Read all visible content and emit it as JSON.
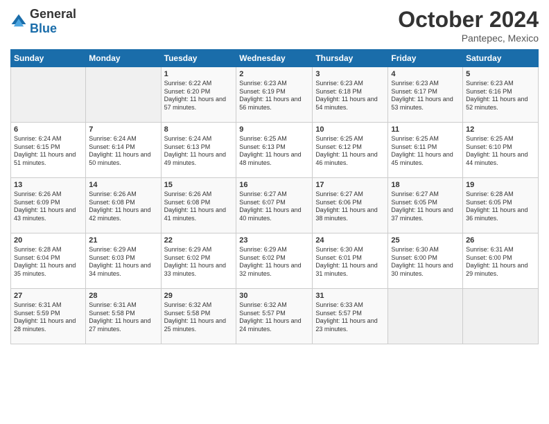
{
  "logo": {
    "general": "General",
    "blue": "Blue"
  },
  "title": "October 2024",
  "subtitle": "Pantepec, Mexico",
  "days_header": [
    "Sunday",
    "Monday",
    "Tuesday",
    "Wednesday",
    "Thursday",
    "Friday",
    "Saturday"
  ],
  "weeks": [
    [
      {
        "day": "",
        "info": ""
      },
      {
        "day": "",
        "info": ""
      },
      {
        "day": "1",
        "info": "Sunrise: 6:22 AM\nSunset: 6:20 PM\nDaylight: 11 hours and 57 minutes."
      },
      {
        "day": "2",
        "info": "Sunrise: 6:23 AM\nSunset: 6:19 PM\nDaylight: 11 hours and 56 minutes."
      },
      {
        "day": "3",
        "info": "Sunrise: 6:23 AM\nSunset: 6:18 PM\nDaylight: 11 hours and 54 minutes."
      },
      {
        "day": "4",
        "info": "Sunrise: 6:23 AM\nSunset: 6:17 PM\nDaylight: 11 hours and 53 minutes."
      },
      {
        "day": "5",
        "info": "Sunrise: 6:23 AM\nSunset: 6:16 PM\nDaylight: 11 hours and 52 minutes."
      }
    ],
    [
      {
        "day": "6",
        "info": "Sunrise: 6:24 AM\nSunset: 6:15 PM\nDaylight: 11 hours and 51 minutes."
      },
      {
        "day": "7",
        "info": "Sunrise: 6:24 AM\nSunset: 6:14 PM\nDaylight: 11 hours and 50 minutes."
      },
      {
        "day": "8",
        "info": "Sunrise: 6:24 AM\nSunset: 6:13 PM\nDaylight: 11 hours and 49 minutes."
      },
      {
        "day": "9",
        "info": "Sunrise: 6:25 AM\nSunset: 6:13 PM\nDaylight: 11 hours and 48 minutes."
      },
      {
        "day": "10",
        "info": "Sunrise: 6:25 AM\nSunset: 6:12 PM\nDaylight: 11 hours and 46 minutes."
      },
      {
        "day": "11",
        "info": "Sunrise: 6:25 AM\nSunset: 6:11 PM\nDaylight: 11 hours and 45 minutes."
      },
      {
        "day": "12",
        "info": "Sunrise: 6:25 AM\nSunset: 6:10 PM\nDaylight: 11 hours and 44 minutes."
      }
    ],
    [
      {
        "day": "13",
        "info": "Sunrise: 6:26 AM\nSunset: 6:09 PM\nDaylight: 11 hours and 43 minutes."
      },
      {
        "day": "14",
        "info": "Sunrise: 6:26 AM\nSunset: 6:08 PM\nDaylight: 11 hours and 42 minutes."
      },
      {
        "day": "15",
        "info": "Sunrise: 6:26 AM\nSunset: 6:08 PM\nDaylight: 11 hours and 41 minutes."
      },
      {
        "day": "16",
        "info": "Sunrise: 6:27 AM\nSunset: 6:07 PM\nDaylight: 11 hours and 40 minutes."
      },
      {
        "day": "17",
        "info": "Sunrise: 6:27 AM\nSunset: 6:06 PM\nDaylight: 11 hours and 38 minutes."
      },
      {
        "day": "18",
        "info": "Sunrise: 6:27 AM\nSunset: 6:05 PM\nDaylight: 11 hours and 37 minutes."
      },
      {
        "day": "19",
        "info": "Sunrise: 6:28 AM\nSunset: 6:05 PM\nDaylight: 11 hours and 36 minutes."
      }
    ],
    [
      {
        "day": "20",
        "info": "Sunrise: 6:28 AM\nSunset: 6:04 PM\nDaylight: 11 hours and 35 minutes."
      },
      {
        "day": "21",
        "info": "Sunrise: 6:29 AM\nSunset: 6:03 PM\nDaylight: 11 hours and 34 minutes."
      },
      {
        "day": "22",
        "info": "Sunrise: 6:29 AM\nSunset: 6:02 PM\nDaylight: 11 hours and 33 minutes."
      },
      {
        "day": "23",
        "info": "Sunrise: 6:29 AM\nSunset: 6:02 PM\nDaylight: 11 hours and 32 minutes."
      },
      {
        "day": "24",
        "info": "Sunrise: 6:30 AM\nSunset: 6:01 PM\nDaylight: 11 hours and 31 minutes."
      },
      {
        "day": "25",
        "info": "Sunrise: 6:30 AM\nSunset: 6:00 PM\nDaylight: 11 hours and 30 minutes."
      },
      {
        "day": "26",
        "info": "Sunrise: 6:31 AM\nSunset: 6:00 PM\nDaylight: 11 hours and 29 minutes."
      }
    ],
    [
      {
        "day": "27",
        "info": "Sunrise: 6:31 AM\nSunset: 5:59 PM\nDaylight: 11 hours and 28 minutes."
      },
      {
        "day": "28",
        "info": "Sunrise: 6:31 AM\nSunset: 5:58 PM\nDaylight: 11 hours and 27 minutes."
      },
      {
        "day": "29",
        "info": "Sunrise: 6:32 AM\nSunset: 5:58 PM\nDaylight: 11 hours and 25 minutes."
      },
      {
        "day": "30",
        "info": "Sunrise: 6:32 AM\nSunset: 5:57 PM\nDaylight: 11 hours and 24 minutes."
      },
      {
        "day": "31",
        "info": "Sunrise: 6:33 AM\nSunset: 5:57 PM\nDaylight: 11 hours and 23 minutes."
      },
      {
        "day": "",
        "info": ""
      },
      {
        "day": "",
        "info": ""
      }
    ]
  ]
}
